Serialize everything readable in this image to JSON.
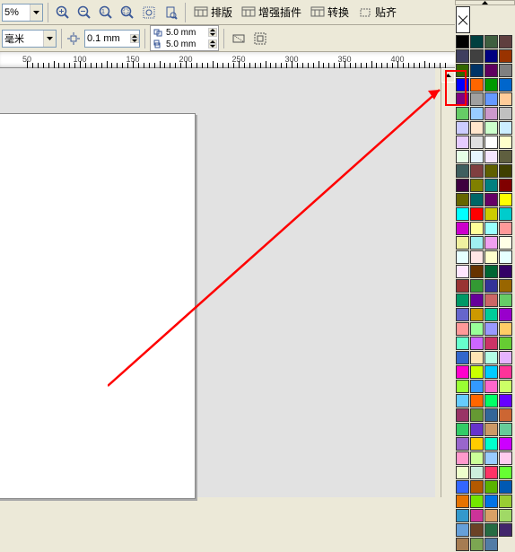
{
  "toolbar1": {
    "zoom": "5%",
    "menus": [
      {
        "label": "排版"
      },
      {
        "label": "增强插件"
      },
      {
        "label": "转换"
      },
      {
        "label": "贴齐"
      }
    ]
  },
  "toolbar2": {
    "units": "毫米",
    "outline_w": "0.1 mm",
    "nudge_x": "5.0 mm",
    "nudge_y": "5.0 mm"
  },
  "ruler": {
    "majors": [
      50,
      100,
      150,
      200,
      250,
      300,
      350,
      400
    ]
  },
  "palette": {
    "swatches": [
      "none",
      "#000000",
      "#003f3f",
      "#3f5f3f",
      "#5f3f3f",
      "#3f3f5f",
      "#404040",
      "#000080",
      "#993300",
      "#336600",
      "#003366",
      "#5f005f",
      "#808080",
      "#0000ff",
      "#ff6600",
      "#009900",
      "#0066cc",
      "#800080",
      "#a0a0a0",
      "#6699ff",
      "#ffcc99",
      "#66cc66",
      "#99ccff",
      "#cc99cc",
      "#c0c0c0",
      "#ccccff",
      "#ffe6cc",
      "#ccffcc",
      "#cceeff",
      "#e6ccff",
      "#e0e0e0",
      "#ffffff",
      "#ffffcc",
      "#e6ffe6",
      "#e6f5ff",
      "#f5e6ff",
      "#5f5f3f",
      "#3f5f5f",
      "#7f3f3f",
      "#5f5f00",
      "#3f3f00",
      "#3f003f",
      "#808000",
      "#008080",
      "#800000",
      "#666600",
      "#006666",
      "#660066",
      "#ffff00",
      "#00ffff",
      "#ff0000",
      "#cccc00",
      "#00cccc",
      "#cc00cc",
      "#ffff99",
      "#99ffff",
      "#ff9999",
      "#f0f0a0",
      "#a0f0f0",
      "#f0a0f0",
      "#ffffe6",
      "#e6ffff",
      "#ffe6e6",
      "#ffffcc",
      "#e6ffff",
      "#ffe6ff",
      "#663300",
      "#006633",
      "#330066",
      "#993333",
      "#339933",
      "#333399",
      "#996600",
      "#009966",
      "#660099",
      "#cc6666",
      "#66cc66",
      "#6666cc",
      "#cc9900",
      "#00cc99",
      "#9900cc",
      "#ff9999",
      "#99ff99",
      "#9999ff",
      "#ffcc66",
      "#66ffcc",
      "#cc66ff",
      "#cc3366",
      "#66cc33",
      "#3366cc",
      "#ffe6b3",
      "#b3ffe6",
      "#e6b3ff",
      "#ff00cc",
      "#ccff00",
      "#00ccff",
      "#ff3399",
      "#99ff33",
      "#3399ff",
      "#ff66cc",
      "#ccff66",
      "#66ccff",
      "#ff6600",
      "#00ff66",
      "#6600ff",
      "#993366",
      "#669933",
      "#336699",
      "#cc6633",
      "#33cc66",
      "#6633cc",
      "#cc9966",
      "#66cc99",
      "#9966cc",
      "#ffcc00",
      "#00ffcc",
      "#cc00ff",
      "#ff99cc",
      "#ccff99",
      "#99ccff",
      "#ffccee",
      "#eeffcc",
      "#cceedd",
      "#ff3366",
      "#66ff33",
      "#3366ff",
      "#b35900",
      "#59b300",
      "#0059b3",
      "#e67300",
      "#73e600",
      "#0073e6",
      "#99cc33",
      "#3399cc",
      "#cc3399",
      "#d9a066",
      "#a0d966",
      "#66a0d9",
      "#6b4226",
      "#266b42",
      "#42266b",
      "#a67c52",
      "#7ca652",
      "#527ca6"
    ]
  }
}
